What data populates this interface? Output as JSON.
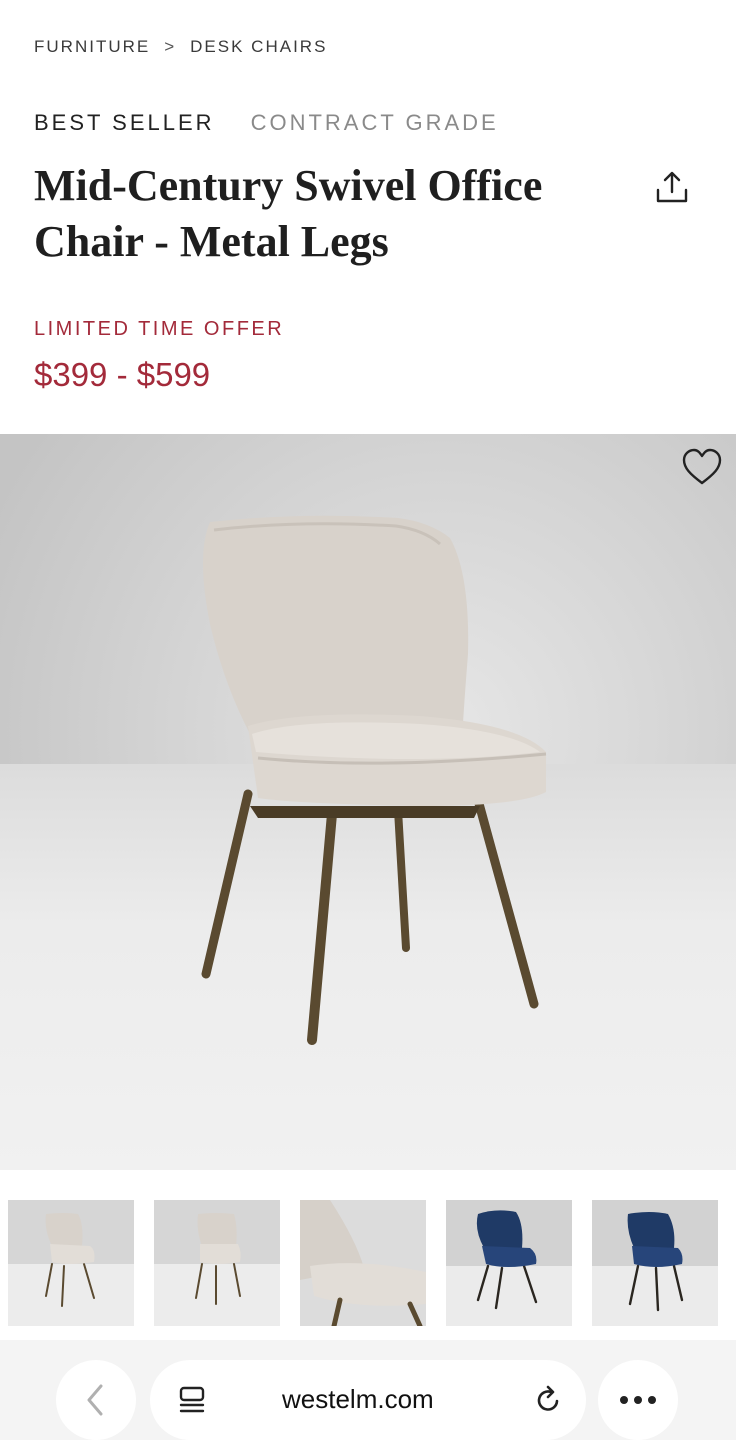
{
  "breadcrumb": {
    "items": [
      "FURNITURE",
      "DESK CHAIRS"
    ],
    "separator": ">"
  },
  "badges": {
    "best_seller": "BEST SELLER",
    "contract_grade": "CONTRACT GRADE"
  },
  "product": {
    "title_line1": "Mid-Century Swivel Office",
    "title_line2": "Chair - Metal Legs",
    "offer_label": "LIMITED TIME OFFER",
    "price_range": "$399 - $599"
  },
  "colors": {
    "accent_red": "#a32a3a",
    "blue_fabric": "#1f3a66",
    "cream_fabric": "#dcd6d0",
    "leg_bronze": "#5a4a30"
  },
  "thumbnails": [
    {
      "icon": "chair-cream-thumbnail",
      "color": "cream"
    },
    {
      "icon": "chair-cream-side-thumbnail",
      "color": "cream"
    },
    {
      "icon": "chair-cream-closeup-thumbnail",
      "color": "cream"
    },
    {
      "icon": "chair-blue-thumbnail",
      "color": "blue"
    },
    {
      "icon": "chair-blue-alt-thumbnail",
      "color": "blue"
    }
  ],
  "browser": {
    "url": "westelm.com"
  }
}
